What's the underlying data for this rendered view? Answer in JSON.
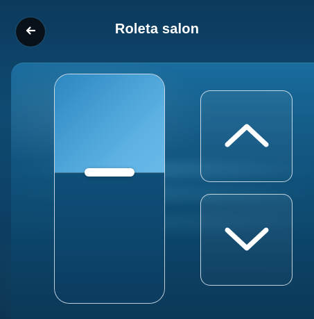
{
  "header": {
    "title": "Roleta salon"
  },
  "icons": {
    "back": "arrow-left-icon",
    "up": "chevron-up-icon",
    "down": "chevron-down-icon"
  },
  "blind_position": {
    "open_fraction": 0.43
  },
  "colors": {
    "panel_accent": "#1a6d9e",
    "slider_open_fill": "#5fb3e4",
    "button_border": "#ffffff"
  }
}
